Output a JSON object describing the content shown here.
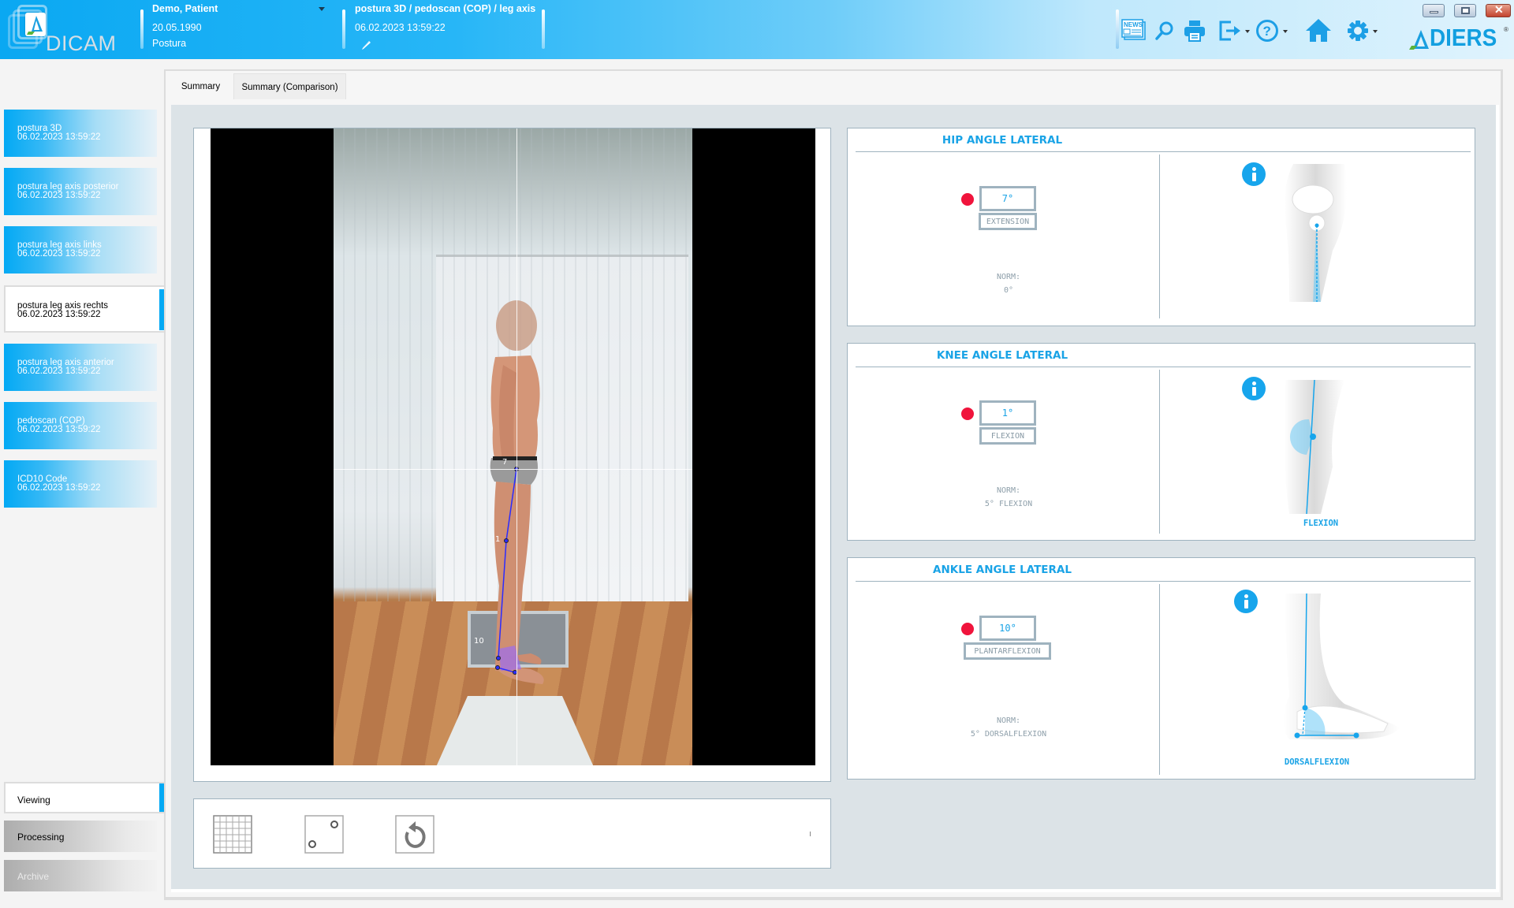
{
  "header": {
    "app_name": "DICAM",
    "patient": {
      "name": "Demo, Patient",
      "birthdate": "20.05.1990",
      "category": "Postura"
    },
    "exam": {
      "title": "postura 3D / pedoscan (COP) / leg axis",
      "datetime": "06.02.2023 13:59:22"
    },
    "toolbar": [
      {
        "icon": "news-icon",
        "label": "NEWS"
      },
      {
        "icon": "search-icon"
      },
      {
        "icon": "print-icon"
      },
      {
        "icon": "export-icon"
      },
      {
        "icon": "help-icon"
      },
      {
        "icon": "home-icon"
      },
      {
        "icon": "settings-icon"
      }
    ],
    "brand": "DIERS",
    "brand_mark": "®"
  },
  "sidebar": {
    "items": [
      {
        "label": "postura 3D",
        "datetime": "06.02.2023 13:59:22",
        "active": false
      },
      {
        "label": "postura leg axis posterior",
        "datetime": "06.02.2023 13:59:22",
        "active": false
      },
      {
        "label": "postura leg axis links",
        "datetime": "06.02.2023 13:59:22",
        "active": false
      },
      {
        "label": "postura leg axis rechts",
        "datetime": "06.02.2023 13:59:22",
        "active": true
      },
      {
        "label": "postura leg axis anterior",
        "datetime": "06.02.2023 13:59:22",
        "active": false
      },
      {
        "label": "pedoscan (COP)",
        "datetime": "06.02.2023 13:59:22",
        "active": false
      },
      {
        "label": "ICD10 Code",
        "datetime": "06.02.2023 13:59:22",
        "active": false
      }
    ],
    "modes": [
      {
        "label": "Viewing",
        "active": true
      },
      {
        "label": "Processing",
        "active": false
      },
      {
        "label": "Archive",
        "active": false
      }
    ]
  },
  "tabs": [
    {
      "label": "Summary",
      "active": true
    },
    {
      "label": "Summary (Comparison)",
      "active": false
    }
  ],
  "image": {
    "markers": [
      {
        "label": "7"
      },
      {
        "label": "1"
      },
      {
        "label": "10"
      }
    ]
  },
  "image_tools": [
    {
      "icon": "grid-icon"
    },
    {
      "icon": "markers-icon"
    },
    {
      "icon": "reset-rotate-icon"
    }
  ],
  "angles": [
    {
      "title": "HIP ANGLE LATERAL",
      "value": "7°",
      "direction": "EXTENSION",
      "norm_label": "NORM:",
      "norm_value": "0°",
      "illustration_label": "",
      "status_color": "#f0143c"
    },
    {
      "title": "KNEE ANGLE LATERAL",
      "value": "1°",
      "direction": "FLEXION",
      "norm_label": "NORM:",
      "norm_value": "5° FLEXION",
      "illustration_label": "FLEXION",
      "status_color": "#f0143c"
    },
    {
      "title": "ANKLE ANGLE LATERAL",
      "value": "10°",
      "direction": "PLANTARFLEXION",
      "norm_label": "NORM:",
      "norm_value": "5° DORSALFLEXION",
      "illustration_label": "DORSALFLEXION",
      "status_color": "#f0143c"
    }
  ],
  "colors": {
    "accent": "#03a9f4",
    "title_blue": "#19a3e6",
    "alert_red": "#f0143c",
    "border": "#9fb3bf"
  }
}
